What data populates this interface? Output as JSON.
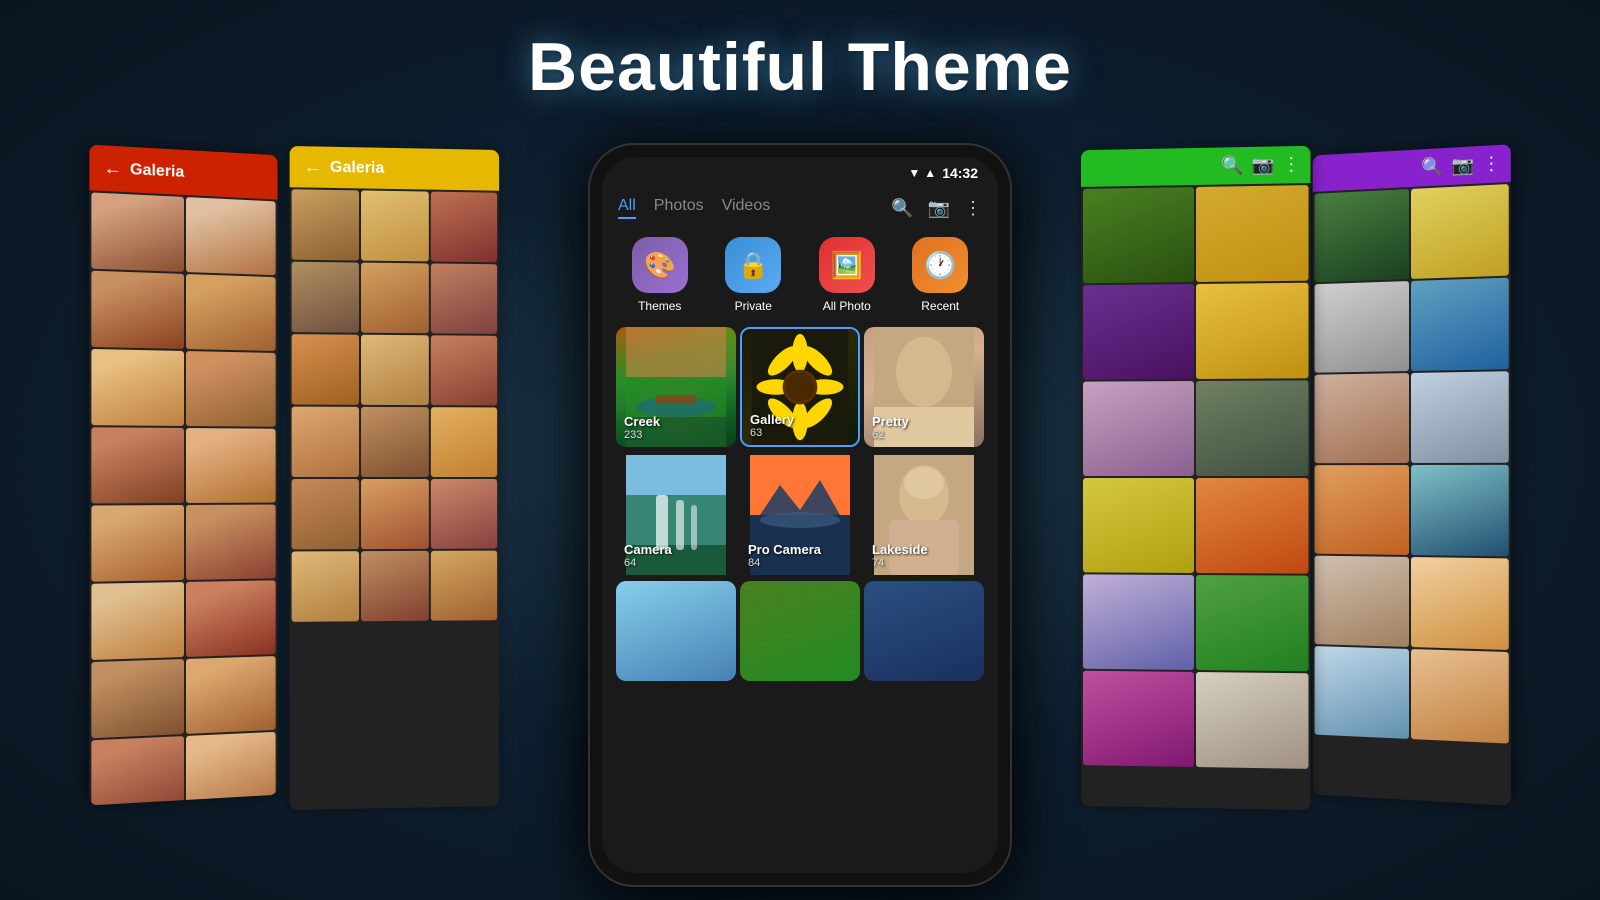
{
  "title": "Beautiful Theme",
  "header": {
    "status": {
      "time": "14:32"
    }
  },
  "phone": {
    "nav": {
      "tabs": [
        {
          "label": "All",
          "active": true
        },
        {
          "label": "Photos",
          "active": false
        },
        {
          "label": "Videos",
          "active": false
        }
      ]
    },
    "quick_icons": [
      {
        "label": "Themes",
        "icon": "🎨",
        "bg_class": "themes-bg"
      },
      {
        "label": "Private",
        "icon": "🔒",
        "bg_class": "private-bg"
      },
      {
        "label": "All Photo",
        "icon": "🖼️",
        "bg_class": "allphoto-bg"
      },
      {
        "label": "Recent",
        "icon": "🕐",
        "bg_class": "recent-bg"
      }
    ],
    "albums": [
      {
        "name": "Creek",
        "count": "233",
        "row": 1
      },
      {
        "name": "Gallery",
        "count": "63",
        "row": 1
      },
      {
        "name": "Pretty",
        "count": "62",
        "row": 1
      },
      {
        "name": "Camera",
        "count": "64",
        "row": 2
      },
      {
        "name": "Pro Camera",
        "count": "84",
        "row": 2
      },
      {
        "name": "Lakeside",
        "count": "74",
        "row": 2
      }
    ]
  },
  "left_panel_red": {
    "title": "Galeria",
    "back_icon": "←"
  },
  "left_panel_yellow": {
    "title": "Galeria",
    "back_icon": "←"
  },
  "right_panel_green": {
    "search_icon": "🔍",
    "camera_icon": "📷",
    "more_icon": "⋮"
  },
  "right_panel_purple": {
    "search_icon": "🔍",
    "camera_icon": "📷",
    "more_icon": "⋮"
  }
}
